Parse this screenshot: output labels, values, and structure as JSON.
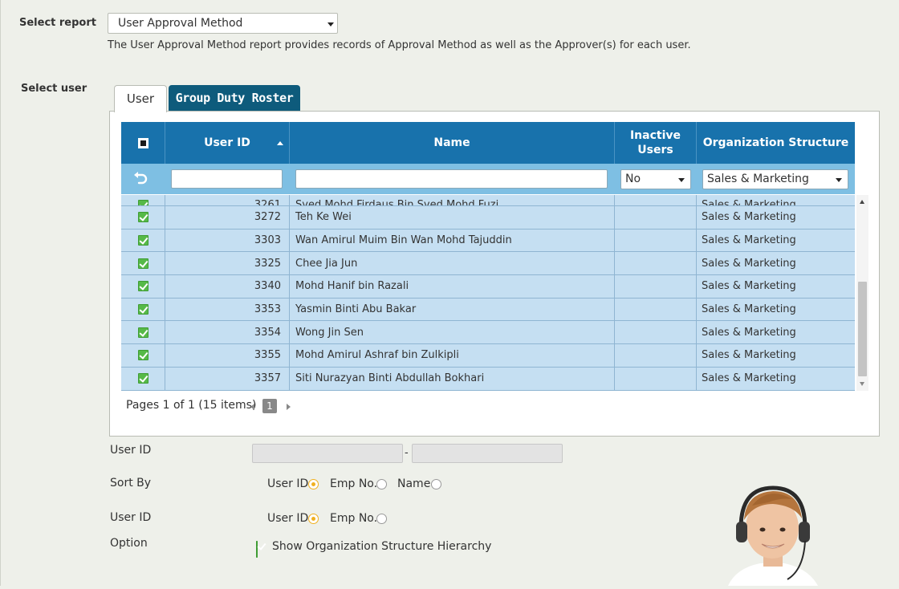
{
  "report": {
    "label": "Select report",
    "selected": "User Approval Method",
    "description": "The User Approval Method report provides records of Approval Method as well as the Approver(s) for each user."
  },
  "select_user": {
    "label": "Select user"
  },
  "tabs": [
    {
      "label": "User",
      "active": true
    },
    {
      "label": "Group Duty Roster",
      "active": false
    }
  ],
  "grid": {
    "columns": {
      "user_id": "User ID",
      "name": "Name",
      "inactive": "Inactive Users",
      "org": "Organization Structure"
    },
    "filters": {
      "inactive": "No",
      "org": "Sales & Marketing"
    },
    "partial_row": {
      "id": "3261",
      "name": "Syed Mohd Firdaus Bin Syed Mohd Fuzi",
      "org": "Sales & Marketing"
    },
    "rows": [
      {
        "id": "3272",
        "name": "Teh Ke Wei",
        "org": "Sales & Marketing"
      },
      {
        "id": "3303",
        "name": "Wan Amirul Muim Bin Wan Mohd Tajuddin",
        "org": "Sales & Marketing"
      },
      {
        "id": "3325",
        "name": "Chee Jia Jun",
        "org": "Sales & Marketing"
      },
      {
        "id": "3340",
        "name": "Mohd Hanif bin Razali",
        "org": "Sales & Marketing"
      },
      {
        "id": "3353",
        "name": "Yasmin Binti Abu Bakar",
        "org": "Sales & Marketing"
      },
      {
        "id": "3354",
        "name": "Wong Jin Sen",
        "org": "Sales & Marketing"
      },
      {
        "id": "3355",
        "name": "Mohd Amirul Ashraf bin Zulkipli",
        "org": "Sales & Marketing"
      },
      {
        "id": "3357",
        "name": "Siti Nurazyan Binti Abdullah Bokhari",
        "org": "Sales & Marketing"
      }
    ],
    "pager": {
      "text": "Pages 1 of 1 (15 items)",
      "page": "1"
    }
  },
  "form": {
    "user_id_range_label": "User ID",
    "range_separator": "-",
    "sort_by_label": "Sort By",
    "sort_options": [
      "User ID",
      "Emp No.",
      "Name"
    ],
    "user_id_label": "User ID",
    "user_id_options": [
      "User ID",
      "Emp No."
    ],
    "option_label": "Option",
    "option_checkbox": "Show Organization Structure Hierarchy"
  },
  "colors": {
    "header": "#1872ac",
    "filter_row": "#7ebfe3",
    "row_bg": "#c5dff2",
    "active_tab_bg": "#0e5b7c",
    "check_green": "#56b948",
    "radio_on": "#f0b020"
  },
  "icons": [
    "select-all-checkbox-icon",
    "sort-asc-icon",
    "undo-icon",
    "chevron-down-icon",
    "check-icon",
    "radio-icon"
  ]
}
